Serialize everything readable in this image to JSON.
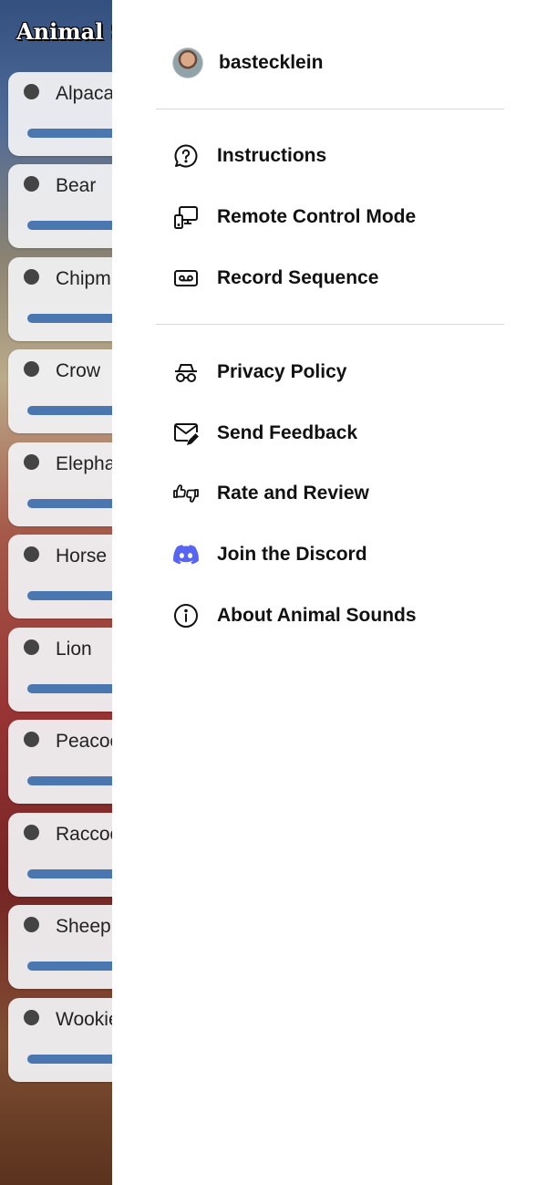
{
  "app": {
    "title": "Animal Sounds",
    "animals": [
      {
        "name": "Alpaca"
      },
      {
        "name": "Bear"
      },
      {
        "name": "Chipmunk"
      },
      {
        "name": "Crow"
      },
      {
        "name": "Elephant"
      },
      {
        "name": "Horse"
      },
      {
        "name": "Lion"
      },
      {
        "name": "Peacock"
      },
      {
        "name": "Raccoon"
      },
      {
        "name": "Sheep"
      },
      {
        "name": "Wookie"
      }
    ]
  },
  "drawer": {
    "profile": {
      "username": "bastecklein"
    },
    "sections": [
      [
        {
          "label": "Instructions",
          "icon": "question-bubble-icon"
        },
        {
          "label": "Remote Control Mode",
          "icon": "remote-devices-icon"
        },
        {
          "label": "Record Sequence",
          "icon": "tape-icon"
        }
      ],
      [
        {
          "label": "Privacy Policy",
          "icon": "incognito-icon"
        },
        {
          "label": "Send Feedback",
          "icon": "mail-edit-icon"
        },
        {
          "label": "Rate and Review",
          "icon": "thumbs-icon"
        },
        {
          "label": "Join the Discord",
          "icon": "discord-icon"
        },
        {
          "label": "About Animal Sounds",
          "icon": "info-icon"
        }
      ]
    ]
  },
  "colors": {
    "discord": "#5865F2",
    "progress_bar": "#4a77b0"
  }
}
